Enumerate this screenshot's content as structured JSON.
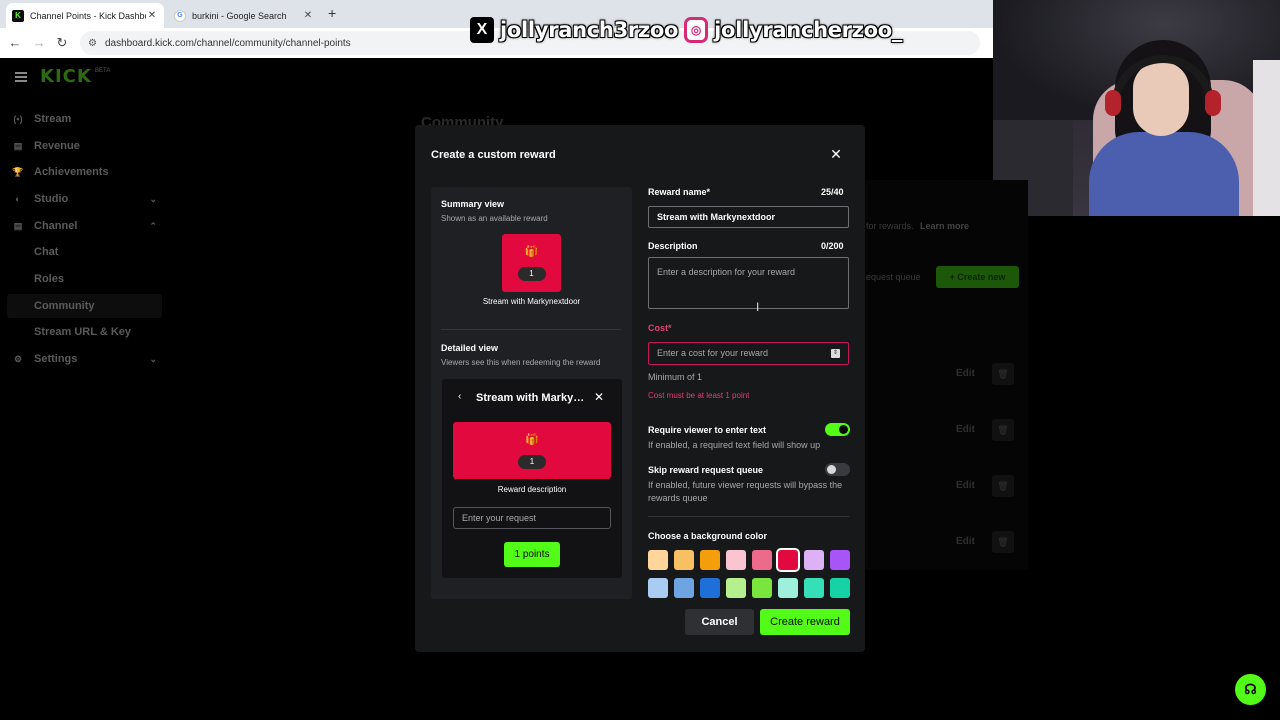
{
  "browser": {
    "tabs": [
      {
        "title": "Channel Points - Kick Dashboard",
        "active": true,
        "favicon": "kick-icon"
      },
      {
        "title": "burkini - Google Search",
        "active": false,
        "favicon": "google-icon"
      }
    ],
    "new_tab": "+",
    "url": "dashboard.kick.com/channel/community/channel-points"
  },
  "overlay": {
    "x_handle": "jollyranch3rzoo",
    "instagram_handle": "jollyrancherzoo_"
  },
  "sidebar": {
    "logo": "KICK",
    "logo_badge": "BETA",
    "items": [
      {
        "label": "Stream",
        "icon": "(•)"
      },
      {
        "label": "Revenue",
        "icon": "▤"
      },
      {
        "label": "Achievements",
        "icon": "🏆"
      },
      {
        "label": "Studio",
        "icon": "◐",
        "chevron": "⌄"
      },
      {
        "label": "Channel",
        "icon": "▤",
        "chevron": "⌃"
      }
    ],
    "channel_sub": [
      "Chat",
      "Roles",
      "Community",
      "Stream URL & Key"
    ],
    "settings": {
      "label": "Settings",
      "icon": "⚙",
      "chevron": "⌄"
    }
  },
  "background": {
    "page_title": "Community",
    "rewards_note": "for rewards.",
    "learn_more": "Learn more",
    "request_queue": "equest queue",
    "create_new": "+ Create new",
    "edit_label": "Edit"
  },
  "modal": {
    "title": "Create a custom reward",
    "summary": {
      "heading": "Summary view",
      "subtitle": "Shown as an available reward",
      "points": "1",
      "reward_name": "Stream with Markynextdoor"
    },
    "detailed": {
      "heading": "Detailed view",
      "subtitle": "Viewers see this when redeeming the reward",
      "title": "Stream with Markynextdoor",
      "points": "1",
      "description": "Reward description",
      "input_placeholder": "Enter your request",
      "button": "1 points"
    },
    "form": {
      "name_label": "Reward name*",
      "name_count": "25/40",
      "name_value": "Stream with Markynextdoor",
      "desc_label": "Description",
      "desc_count": "0/200",
      "desc_placeholder": "Enter a description for your reward",
      "cost_label": "Cost*",
      "cost_placeholder": "Enter a cost for your reward",
      "cost_min": "Minimum of 1",
      "cost_error": "Cost must be at least 1 point",
      "require_label": "Require viewer to enter text",
      "require_help": "If enabled, a required text field will show up",
      "require_on": true,
      "skip_label": "Skip reward request queue",
      "skip_help": "If enabled, future viewer requests will bypass the rewards queue",
      "skip_on": false,
      "color_label": "Choose a background color",
      "colors": [
        "#ffd699",
        "#f9bf63",
        "#f59e0b",
        "#fbc4d1",
        "#ec6b8a",
        "#e2093f",
        "#dcb2f5",
        "#a855f7",
        "#a9ccf2",
        "#6fa4e3",
        "#1f6fd8",
        "#b6f08e",
        "#7ae53c",
        "#9ef0dd",
        "#35dfb8",
        "#15d3a7"
      ],
      "selected_color": "#e2093f"
    },
    "buttons": {
      "cancel": "Cancel",
      "create": "Create reward"
    }
  }
}
